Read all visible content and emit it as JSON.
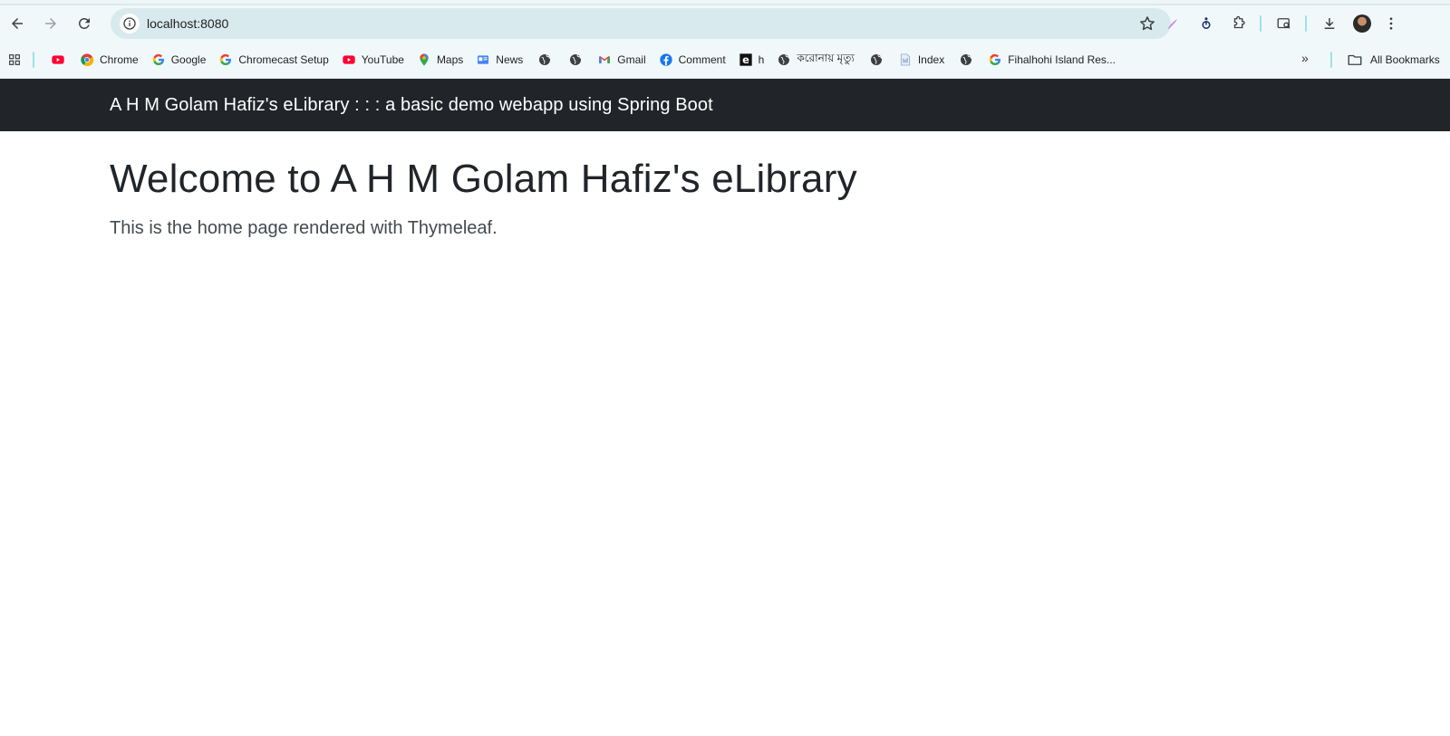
{
  "browser": {
    "url": "localhost:8080",
    "bookmarks": [
      {
        "label": "",
        "icon": "youtube-icon"
      },
      {
        "label": "Chrome",
        "icon": "chrome-icon"
      },
      {
        "label": "Google",
        "icon": "google-icon"
      },
      {
        "label": "Chromecast Setup",
        "icon": "google-icon"
      },
      {
        "label": "YouTube",
        "icon": "youtube-icon"
      },
      {
        "label": "Maps",
        "icon": "maps-icon"
      },
      {
        "label": "News",
        "icon": "news-icon"
      },
      {
        "label": "",
        "icon": "globe-icon"
      },
      {
        "label": "",
        "icon": "globe-icon"
      },
      {
        "label": "Gmail",
        "icon": "gmail-icon"
      },
      {
        "label": "Comment",
        "icon": "facebook-icon"
      },
      {
        "label": "h",
        "icon": "e-icon"
      },
      {
        "label": "করোনায় মৃত্যু",
        "icon": "globe-icon"
      },
      {
        "label": "",
        "icon": "globe-icon"
      },
      {
        "label": "Index",
        "icon": "document-icon"
      },
      {
        "label": "",
        "icon": "globe-icon"
      },
      {
        "label": "Fihalhohi Island Res...",
        "icon": "google-icon"
      }
    ],
    "more_label": "»",
    "all_bookmarks_label": "All Bookmarks"
  },
  "page": {
    "brand": "A H M Golam Hafiz's eLibrary : : : a basic demo webapp using Spring Boot",
    "title": "Welcome to A H M Golam Hafiz's eLibrary",
    "lead": "This is the home page rendered with Thymeleaf."
  },
  "colors": {
    "navbar_bg": "#212529",
    "chrome_bg": "#f1f8fa",
    "omnibox_bg": "#d9eaee"
  }
}
